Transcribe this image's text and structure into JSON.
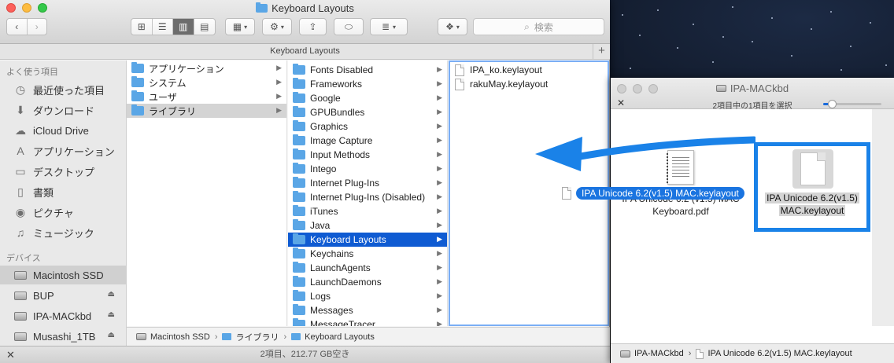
{
  "main_window": {
    "title": "Keyboard Layouts",
    "search_placeholder": "検索",
    "path_tab": "Keyboard Layouts",
    "status": "2項目、212.77 GB空き"
  },
  "sidebar": {
    "favorites_header": "よく使う項目",
    "favorites": [
      {
        "label": "最近使った項目",
        "icon": "clock-icon"
      },
      {
        "label": "ダウンロード",
        "icon": "download-icon"
      },
      {
        "label": "iCloud Drive",
        "icon": "cloud-icon"
      },
      {
        "label": "アプリケーション",
        "icon": "apps-icon"
      },
      {
        "label": "デスクトップ",
        "icon": "desktop-icon"
      },
      {
        "label": "書類",
        "icon": "documents-icon"
      },
      {
        "label": "ピクチャ",
        "icon": "camera-icon"
      },
      {
        "label": "ミュージック",
        "icon": "music-icon"
      }
    ],
    "devices_header": "デバイス",
    "devices": [
      {
        "label": "Macintosh SSD",
        "selected": true,
        "eject": false
      },
      {
        "label": "BUP",
        "eject": true
      },
      {
        "label": "IPA-MACkbd",
        "eject": true
      },
      {
        "label": "Musashi_1TB",
        "eject": true
      }
    ]
  },
  "columns": {
    "col1": [
      {
        "label": "アプリケーション"
      },
      {
        "label": "システム"
      },
      {
        "label": "ユーザ"
      },
      {
        "label": "ライブラリ",
        "highlighted": true
      }
    ],
    "col2": [
      {
        "label": "Fonts Disabled"
      },
      {
        "label": "Frameworks"
      },
      {
        "label": "Google"
      },
      {
        "label": "GPUBundles"
      },
      {
        "label": "Graphics"
      },
      {
        "label": "Image Capture"
      },
      {
        "label": "Input Methods"
      },
      {
        "label": "Intego"
      },
      {
        "label": "Internet Plug-Ins"
      },
      {
        "label": "Internet Plug-Ins (Disabled)"
      },
      {
        "label": "iTunes"
      },
      {
        "label": "Java"
      },
      {
        "label": "Keyboard Layouts",
        "selected": true
      },
      {
        "label": "Keychains"
      },
      {
        "label": "LaunchAgents"
      },
      {
        "label": "LaunchDaemons"
      },
      {
        "label": "Logs"
      },
      {
        "label": "Messages"
      },
      {
        "label": "MessageTracer"
      }
    ],
    "col3": [
      {
        "label": "IPA_ko.keylayout"
      },
      {
        "label": "rakuMay.keylayout"
      }
    ]
  },
  "path_bar": [
    "Macintosh SSD",
    "ライブラリ",
    "Keyboard Layouts"
  ],
  "second_window": {
    "title": "IPA-MACkbd",
    "subtitle": "2項目中の1項目を選択",
    "icon_size_fraction": 0.15,
    "pdf_label_line1": "IPA Unicode 6.2 (v1.5) MAC",
    "pdf_label_line2": "Keyboard.pdf",
    "selected_label_line1": "IPA Unicode 6.2(v1.5)",
    "selected_label_line2": "MAC.keylayout",
    "path": [
      "IPA-MACkbd",
      "IPA Unicode 6.2(v1.5) MAC.keylayout"
    ]
  },
  "drag_label": "IPA Unicode 6.2(v1.5) MAC.keylayout",
  "colors": {
    "selection": "#0f5bd2",
    "highlight_box": "#1a82e8",
    "folder": "#5aa6e6",
    "arrow": "#1a82e8"
  }
}
